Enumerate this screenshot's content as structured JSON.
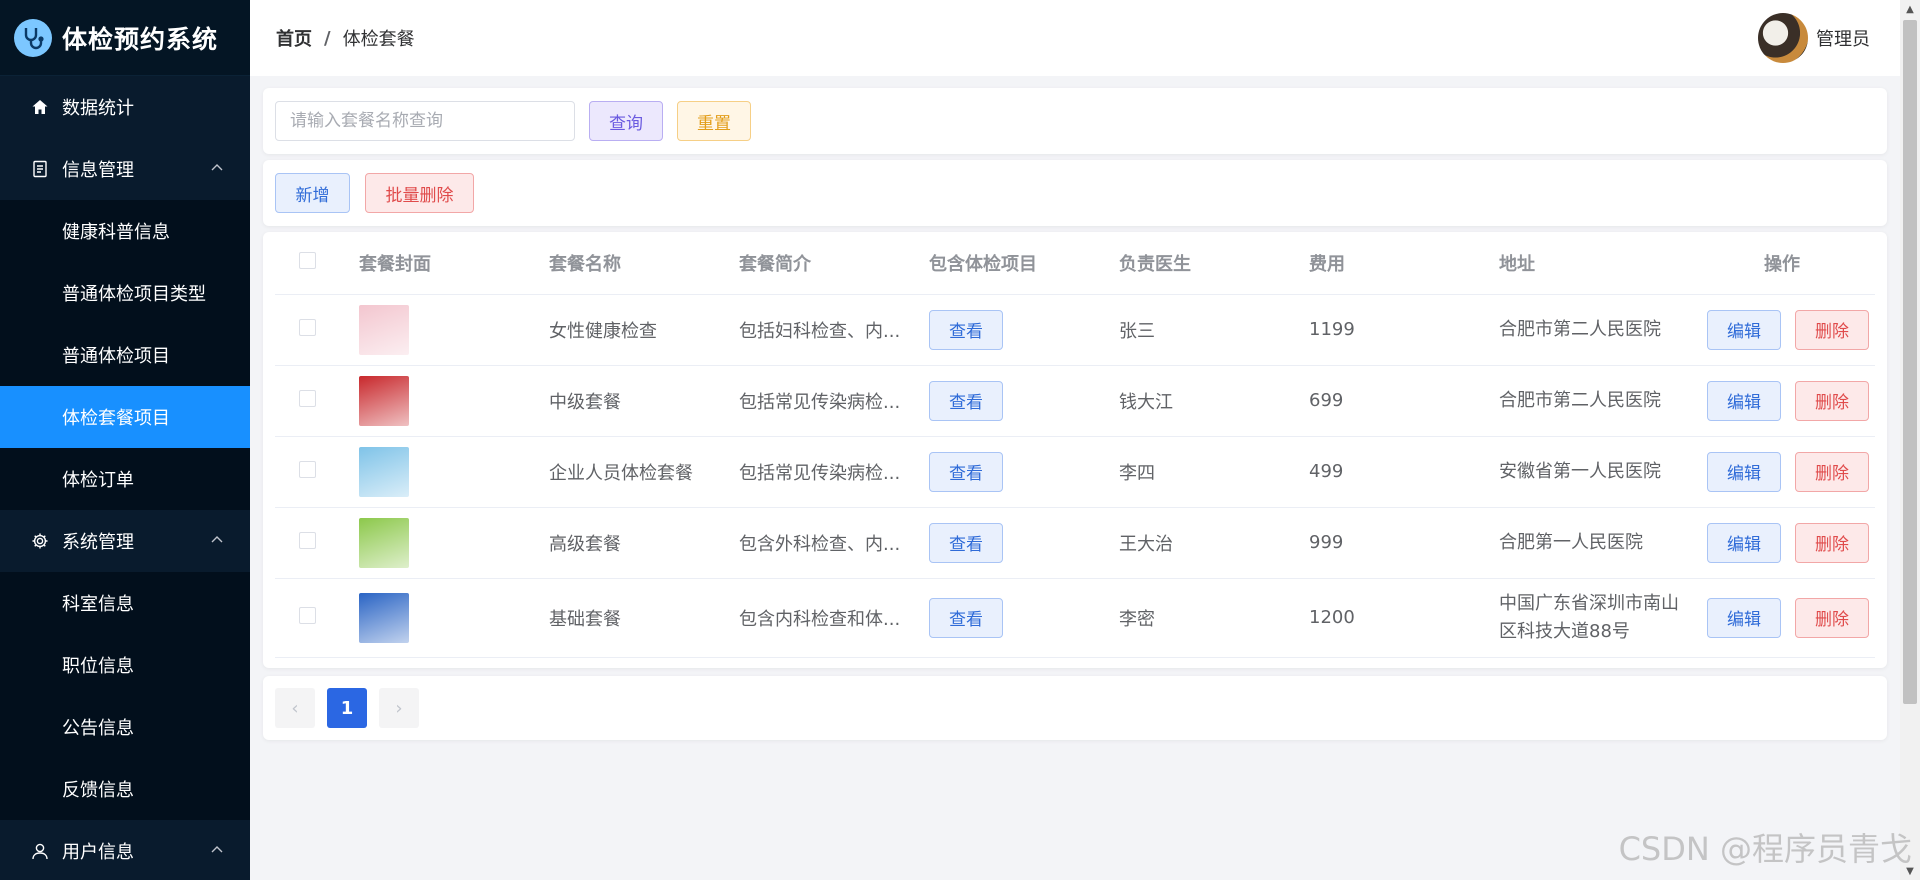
{
  "app": {
    "title": "体检预约系统"
  },
  "sidebar": {
    "items": [
      {
        "label": "数据统计",
        "icon": "home-icon"
      },
      {
        "label": "信息管理",
        "icon": "document-icon",
        "expanded": true,
        "children": [
          "健康科普信息",
          "普通体检项目类型",
          "普通体检项目",
          "体检套餐项目",
          "体检订单"
        ]
      },
      {
        "label": "系统管理",
        "icon": "gear-icon",
        "expanded": true,
        "children": [
          "科室信息",
          "职位信息",
          "公告信息",
          "反馈信息"
        ]
      },
      {
        "label": "用户信息",
        "icon": "user-icon",
        "expanded": true
      }
    ],
    "active": "体检套餐项目"
  },
  "header": {
    "breadcrumb": {
      "home": "首页",
      "separator": "/",
      "current": "体检套餐"
    },
    "user": {
      "name": "管理员"
    }
  },
  "search": {
    "placeholder": "请输入套餐名称查询",
    "value": "",
    "query_label": "查询",
    "reset_label": "重置"
  },
  "actions": {
    "add_label": "新增",
    "batch_delete_label": "批量删除"
  },
  "table": {
    "columns": [
      "套餐封面",
      "套餐名称",
      "套餐简介",
      "包含体检项目",
      "负责医生",
      "费用",
      "地址",
      "操作"
    ],
    "view_label": "查看",
    "edit_label": "编辑",
    "delete_label": "删除",
    "rows": [
      {
        "cover_color": "#f3c6cf",
        "name": "女性健康检查",
        "desc": "包括妇科检查、内...",
        "doctor": "张三",
        "fee": "1199",
        "address": "合肥市第二人民医院"
      },
      {
        "cover_color": "#c8282c",
        "name": "中级套餐",
        "desc": "包括常见传染病检...",
        "doctor": "钱大江",
        "fee": "699",
        "address": "合肥市第二人民医院"
      },
      {
        "cover_color": "#7fc3e8",
        "name": "企业人员体检套餐",
        "desc": "包括常见传染病检...",
        "doctor": "李四",
        "fee": "499",
        "address": "安徽省第一人民医院"
      },
      {
        "cover_color": "#8cc84b",
        "name": "高级套餐",
        "desc": "包含外科检查、内...",
        "doctor": "王大治",
        "fee": "999",
        "address": "合肥第一人民医院"
      },
      {
        "cover_color": "#2a64c4",
        "name": "基础套餐",
        "desc": "包含内科检查和体...",
        "doctor": "李密",
        "fee": "1200",
        "address": "中国广东省深圳市南山区科技大道88号"
      }
    ]
  },
  "pagination": {
    "current": "1",
    "prev": "‹",
    "next": "›"
  },
  "watermark": "CSDN @程序员青戈"
}
